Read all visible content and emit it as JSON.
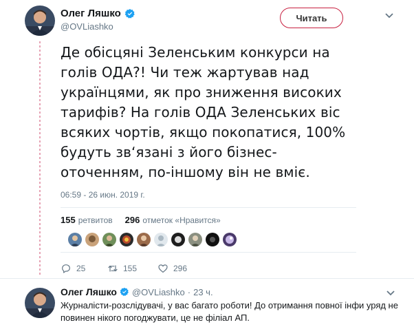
{
  "tweet": {
    "author_name": "Олег Ляшко",
    "author_handle": "@OVLiashko",
    "follow_label": "Читать",
    "text": "Де обісцяні Зеленським конкурси на\nголів ОДА?! Чи теж жартував над\nукраїнцями, як про зниження високих\nтарифів? На голів ОДА Зеленських віс\nвсяких чортів, якщо покопатися, 100%\nбудуть зв‘язані з його бізнес-\nоточенням, по-іншому він не вміє.",
    "timestamp": "06:59 - 26 июн. 2019 г.",
    "retweets_count": "155",
    "retweets_label": "ретвитов",
    "likes_count": "296",
    "likes_label": "отметок «Нравится»",
    "actions": {
      "replies": "25",
      "retweets": "155",
      "likes": "296"
    },
    "icons": {
      "verified": "verified-badge-icon",
      "more": "chevron-down-icon",
      "reply": "reply-icon",
      "retweet": "retweet-icon",
      "like": "heart-icon"
    },
    "colors": {
      "accent": "#c71f3f",
      "verified": "#1da1f2",
      "muted": "#657786"
    }
  },
  "reply": {
    "author_name": "Олег Ляшко",
    "author_handle": "@OVLiashko",
    "separator": "·",
    "time": "23 ч.",
    "text": "Журналісти-розслідувачі, у вас багато роботи! До отримання повної інфи уряд не повинен нікого погоджувати, це не філіал АП."
  }
}
